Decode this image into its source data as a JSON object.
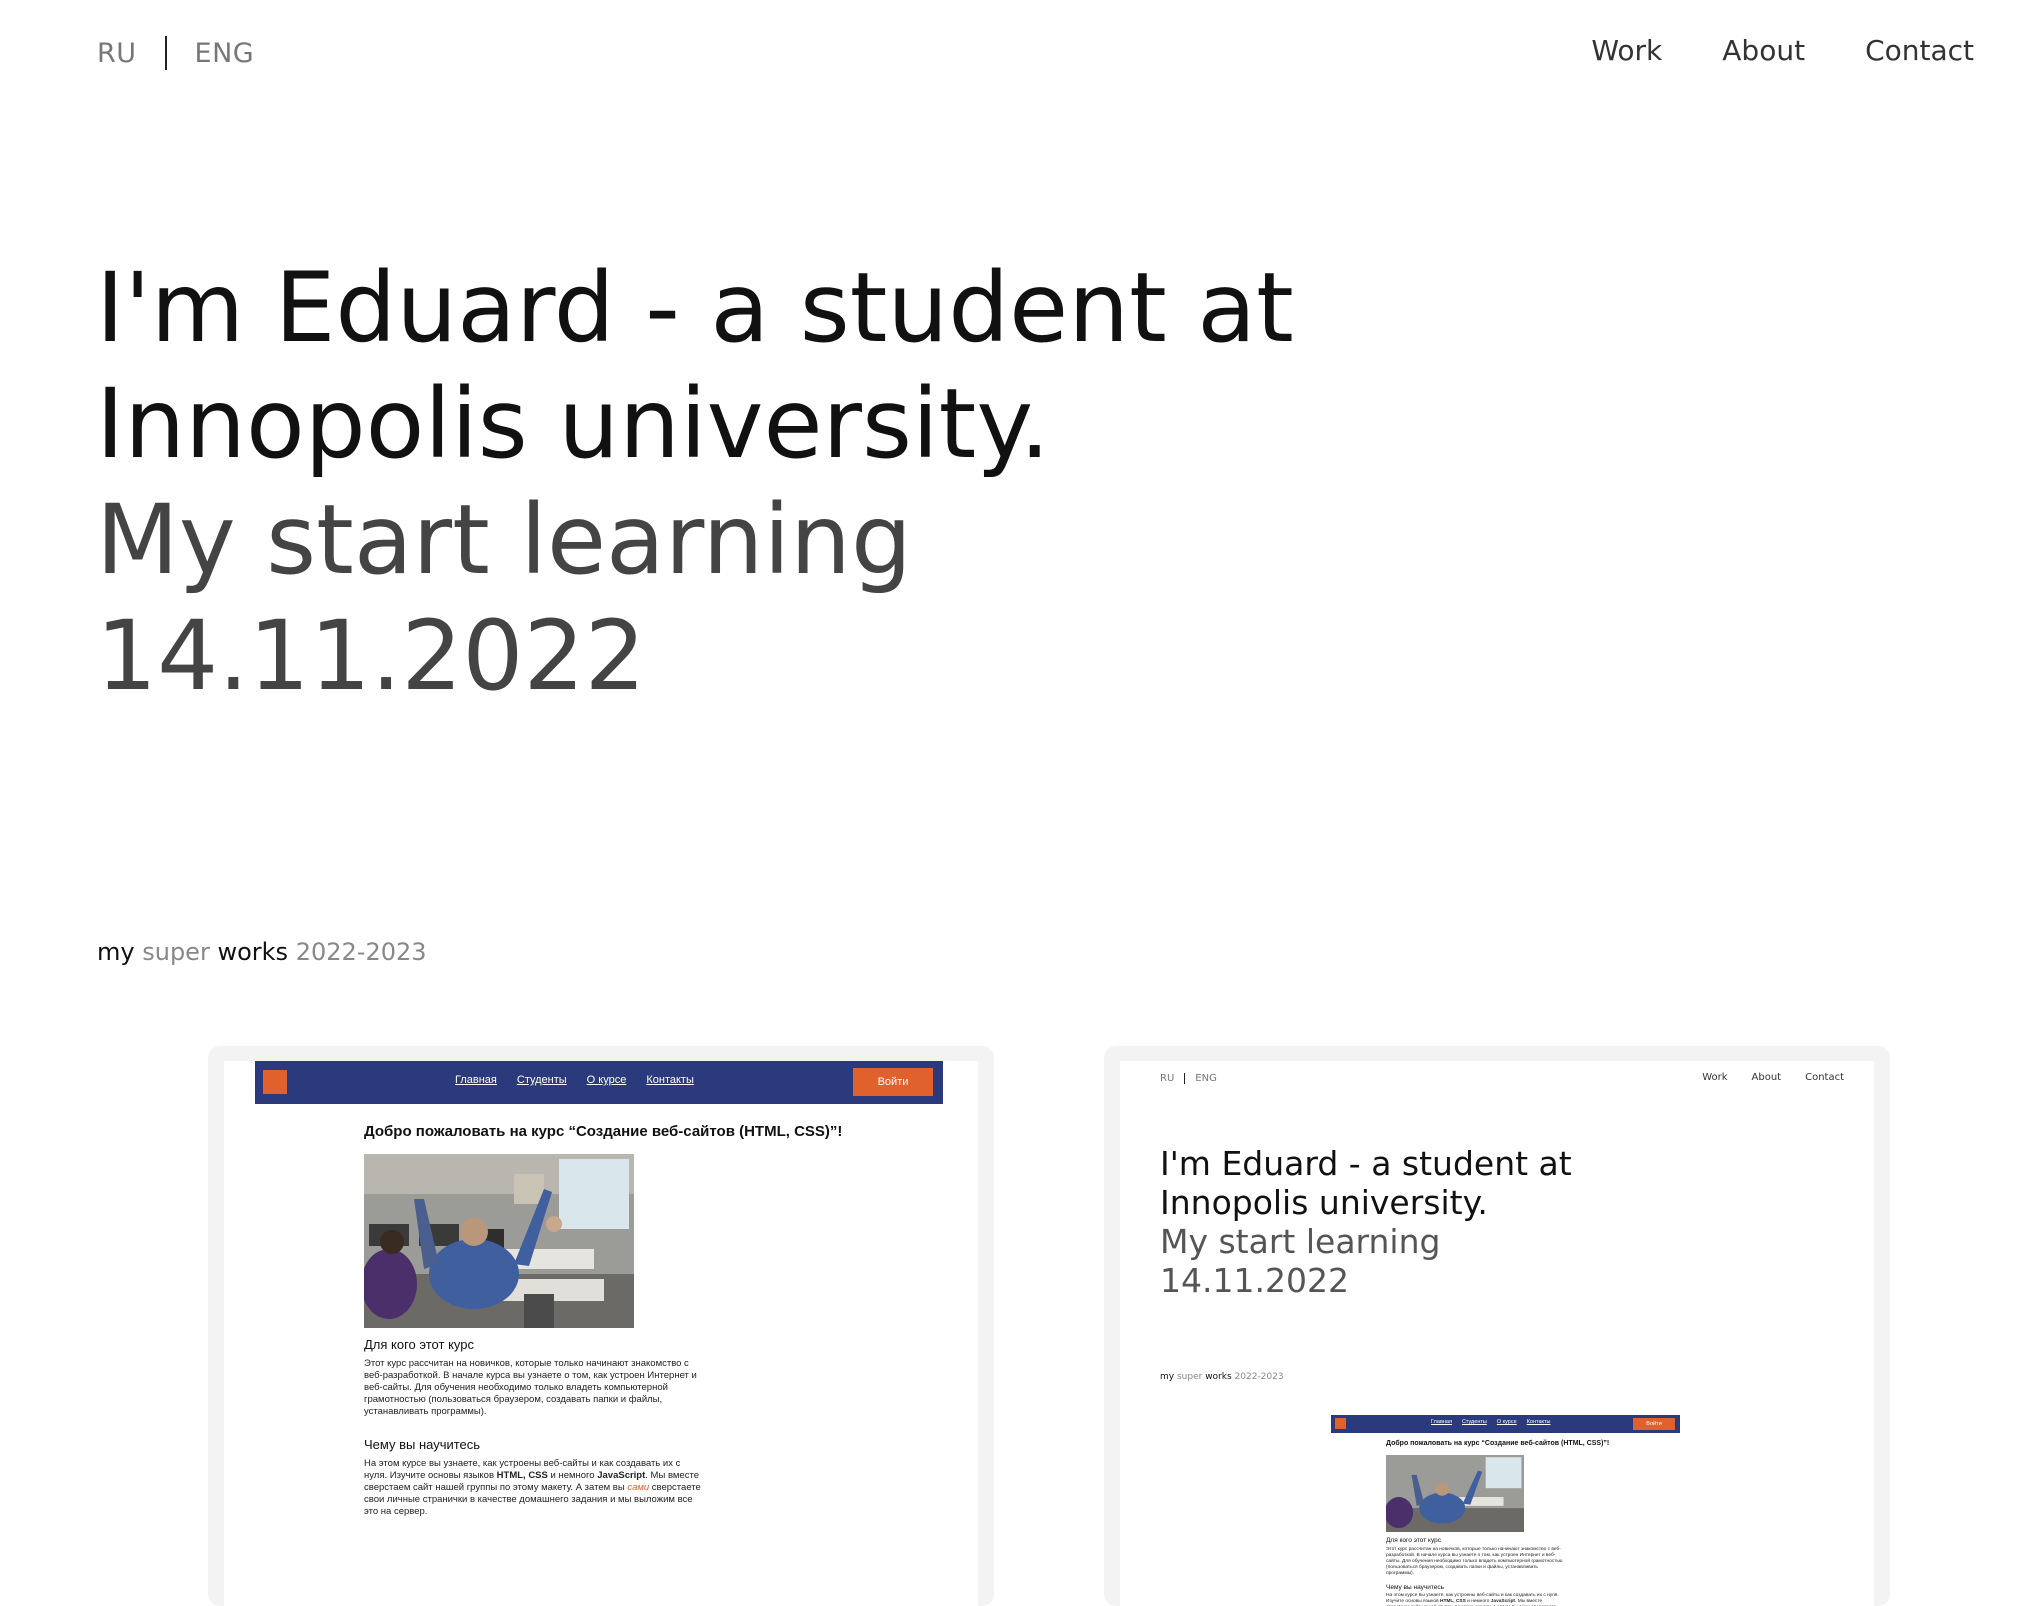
{
  "header": {
    "lang": [
      "RU",
      "ENG"
    ],
    "nav": [
      "Work",
      "About",
      "Contact"
    ]
  },
  "hero": {
    "line1": "I'm Eduard - a student at",
    "line2": "Innopolis university.",
    "line3": "My start learning",
    "line4": "14.11.2022"
  },
  "works_caption": {
    "w1": "my",
    "w2": "super",
    "w3": "works",
    "w4": "2022-2023"
  },
  "course_site": {
    "nav": [
      "Главная",
      "Студенты",
      "О курсе",
      "Контакты"
    ],
    "login": "Войти",
    "title": "Добро пожаловать на курс “Создание веб-сайтов (HTML, CSS)”!",
    "h1": "Для кого этот курс",
    "p1": "Этот курс рассчитан на новичков, которые только начинают знакомство с веб-разработкой. В начале курса вы узнаете о том, как устроен Интернет и веб-сайты. Для обучения необходимо только владеть компьютерной грамотностью (пользоваться браузером, создавать папки и файлы, устанавливать программы).",
    "h2": "Чему вы научитесь",
    "p2_a": "На этом курсе вы узнаете, как устроены веб-сайты и как создавать их с нуля. Изучите основы языков ",
    "p2_b": "HTML, CSS",
    "p2_c": " и немного ",
    "p2_d": "JavaScript",
    "p2_e": ". Мы вместе сверстаем сайт нашей группы по этому макету. А затем вы ",
    "p2_f": "сами",
    "p2_g": " сверстаете свои личные странички в качестве домашнего задания и мы выложим все это на сервер."
  },
  "colors": {
    "course_bar": "#2b3a7c",
    "course_accent": "#e0612c",
    "card_bg": "#f3f3f3"
  }
}
